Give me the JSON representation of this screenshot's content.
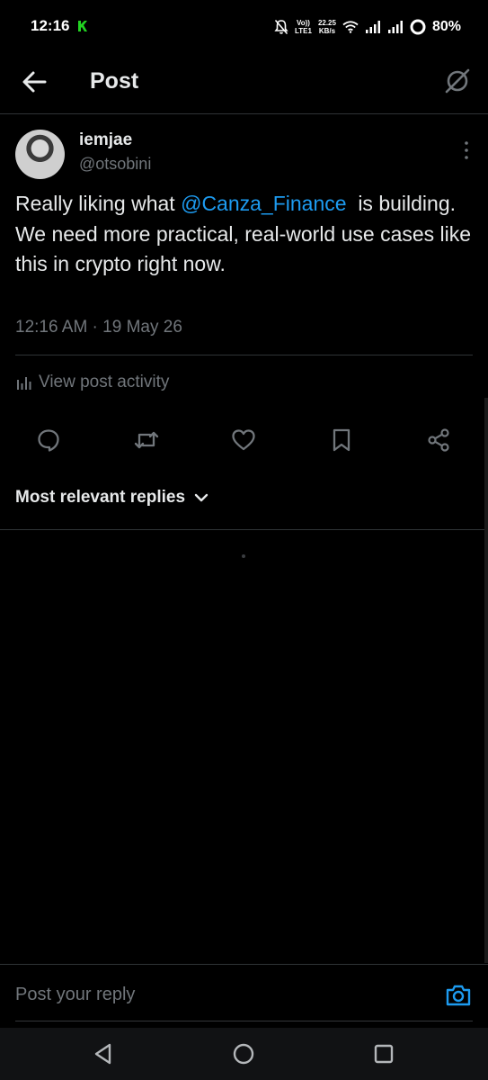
{
  "status_bar": {
    "time": "12:16",
    "network_label_1": "Vo))",
    "network_label_2": "LTE1",
    "speed_value": "22.25",
    "speed_unit": "KB/s",
    "battery": "80%"
  },
  "header": {
    "title": "Post"
  },
  "post": {
    "display_name": "iemjae",
    "handle": "@otsobini",
    "text_before": "Really liking what ",
    "mention": "@Canza_Finance",
    "text_after": "  is building. We need more practical, real-world use cases like this in crypto right now.",
    "timestamp": "12:16 AM · 19 May 26",
    "activity_label": "View post activity"
  },
  "replies": {
    "sort_label": "Most relevant replies"
  },
  "reply_bar": {
    "placeholder": "Post your reply"
  },
  "colors": {
    "background": "#000000",
    "text": "#e7e9ea",
    "muted": "#71767b",
    "accent": "#1d9bf0",
    "divider": "#2f3336"
  }
}
